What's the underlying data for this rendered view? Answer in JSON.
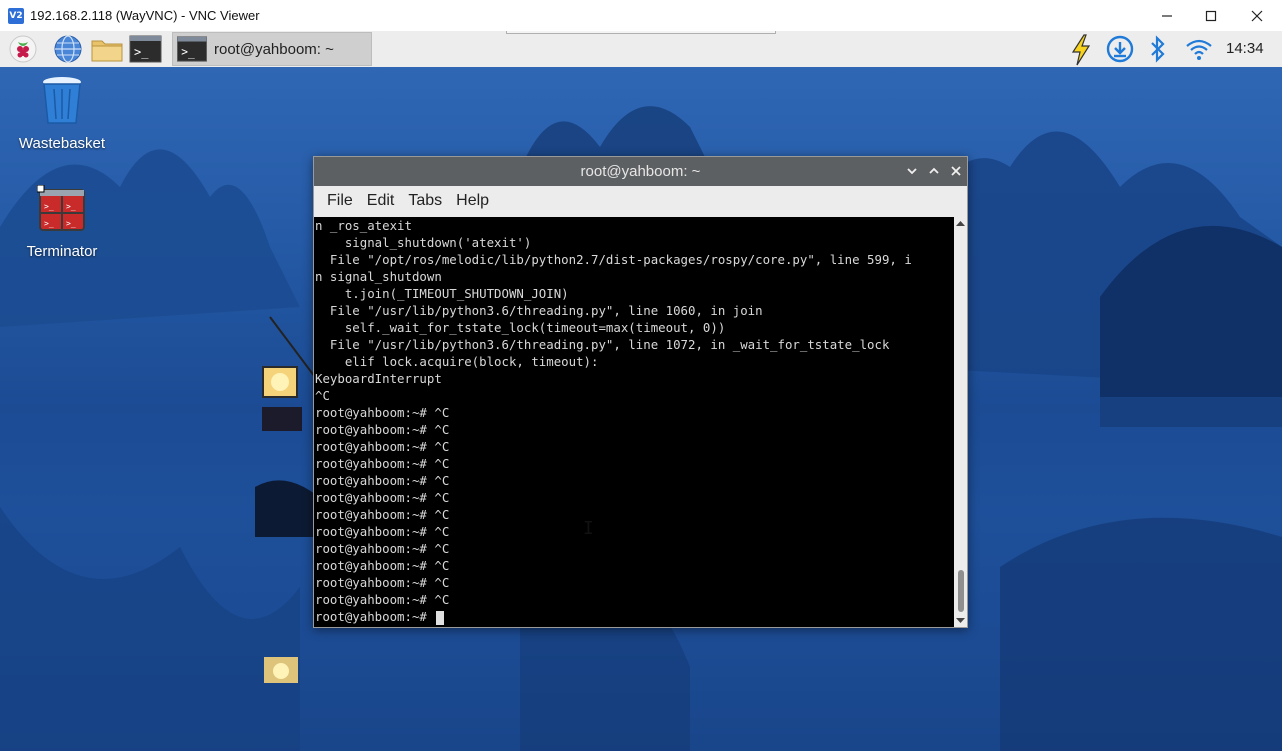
{
  "vnc": {
    "title": "192.168.2.118 (WayVNC) - VNC Viewer",
    "logo_text": "V2",
    "minimize_icon": "minimize-icon",
    "maximize_icon": "maximize-icon",
    "close_icon": "close-icon"
  },
  "panel": {
    "launchers": [
      "raspberry-menu-icon",
      "web-browser-icon",
      "file-manager-icon",
      "terminal-icon"
    ],
    "task_label": "root@yahboom: ~",
    "tray_icons": [
      "power-bolt-icon",
      "download-update-icon",
      "bluetooth-icon",
      "wifi-icon"
    ],
    "clock": "14:34"
  },
  "desktop": {
    "icons": [
      {
        "name": "wastebasket-icon",
        "label": "Wastebasket"
      },
      {
        "name": "terminator-icon",
        "label": "Terminator"
      }
    ]
  },
  "terminal": {
    "title": "root@yahboom: ~",
    "menu": [
      "File",
      "Edit",
      "Tabs",
      "Help"
    ],
    "lines": [
      "n _ros_atexit",
      "    signal_shutdown('atexit')",
      "  File \"/opt/ros/melodic/lib/python2.7/dist-packages/rospy/core.py\", line 599, i",
      "n signal_shutdown",
      "    t.join(_TIMEOUT_SHUTDOWN_JOIN)",
      "  File \"/usr/lib/python3.6/threading.py\", line 1060, in join",
      "    self._wait_for_tstate_lock(timeout=max(timeout, 0))",
      "  File \"/usr/lib/python3.6/threading.py\", line 1072, in _wait_for_tstate_lock",
      "    elif lock.acquire(block, timeout):",
      "KeyboardInterrupt",
      "^C",
      "root@yahboom:~# ^C",
      "root@yahboom:~# ^C",
      "root@yahboom:~# ^C",
      "root@yahboom:~# ^C",
      "root@yahboom:~# ^C",
      "root@yahboom:~# ^C",
      "root@yahboom:~# ^C",
      "root@yahboom:~# ^C",
      "root@yahboom:~# ^C",
      "root@yahboom:~# ^C",
      "root@yahboom:~# ^C",
      "root@yahboom:~# ^C"
    ],
    "prompt": "root@yahboom:~# "
  },
  "colors": {
    "terminal_bg": "#000000",
    "terminal_fg": "#d8d8d8",
    "titlebar": "#5d6062",
    "panel": "#ededed",
    "accent": "#2d6fd6"
  }
}
